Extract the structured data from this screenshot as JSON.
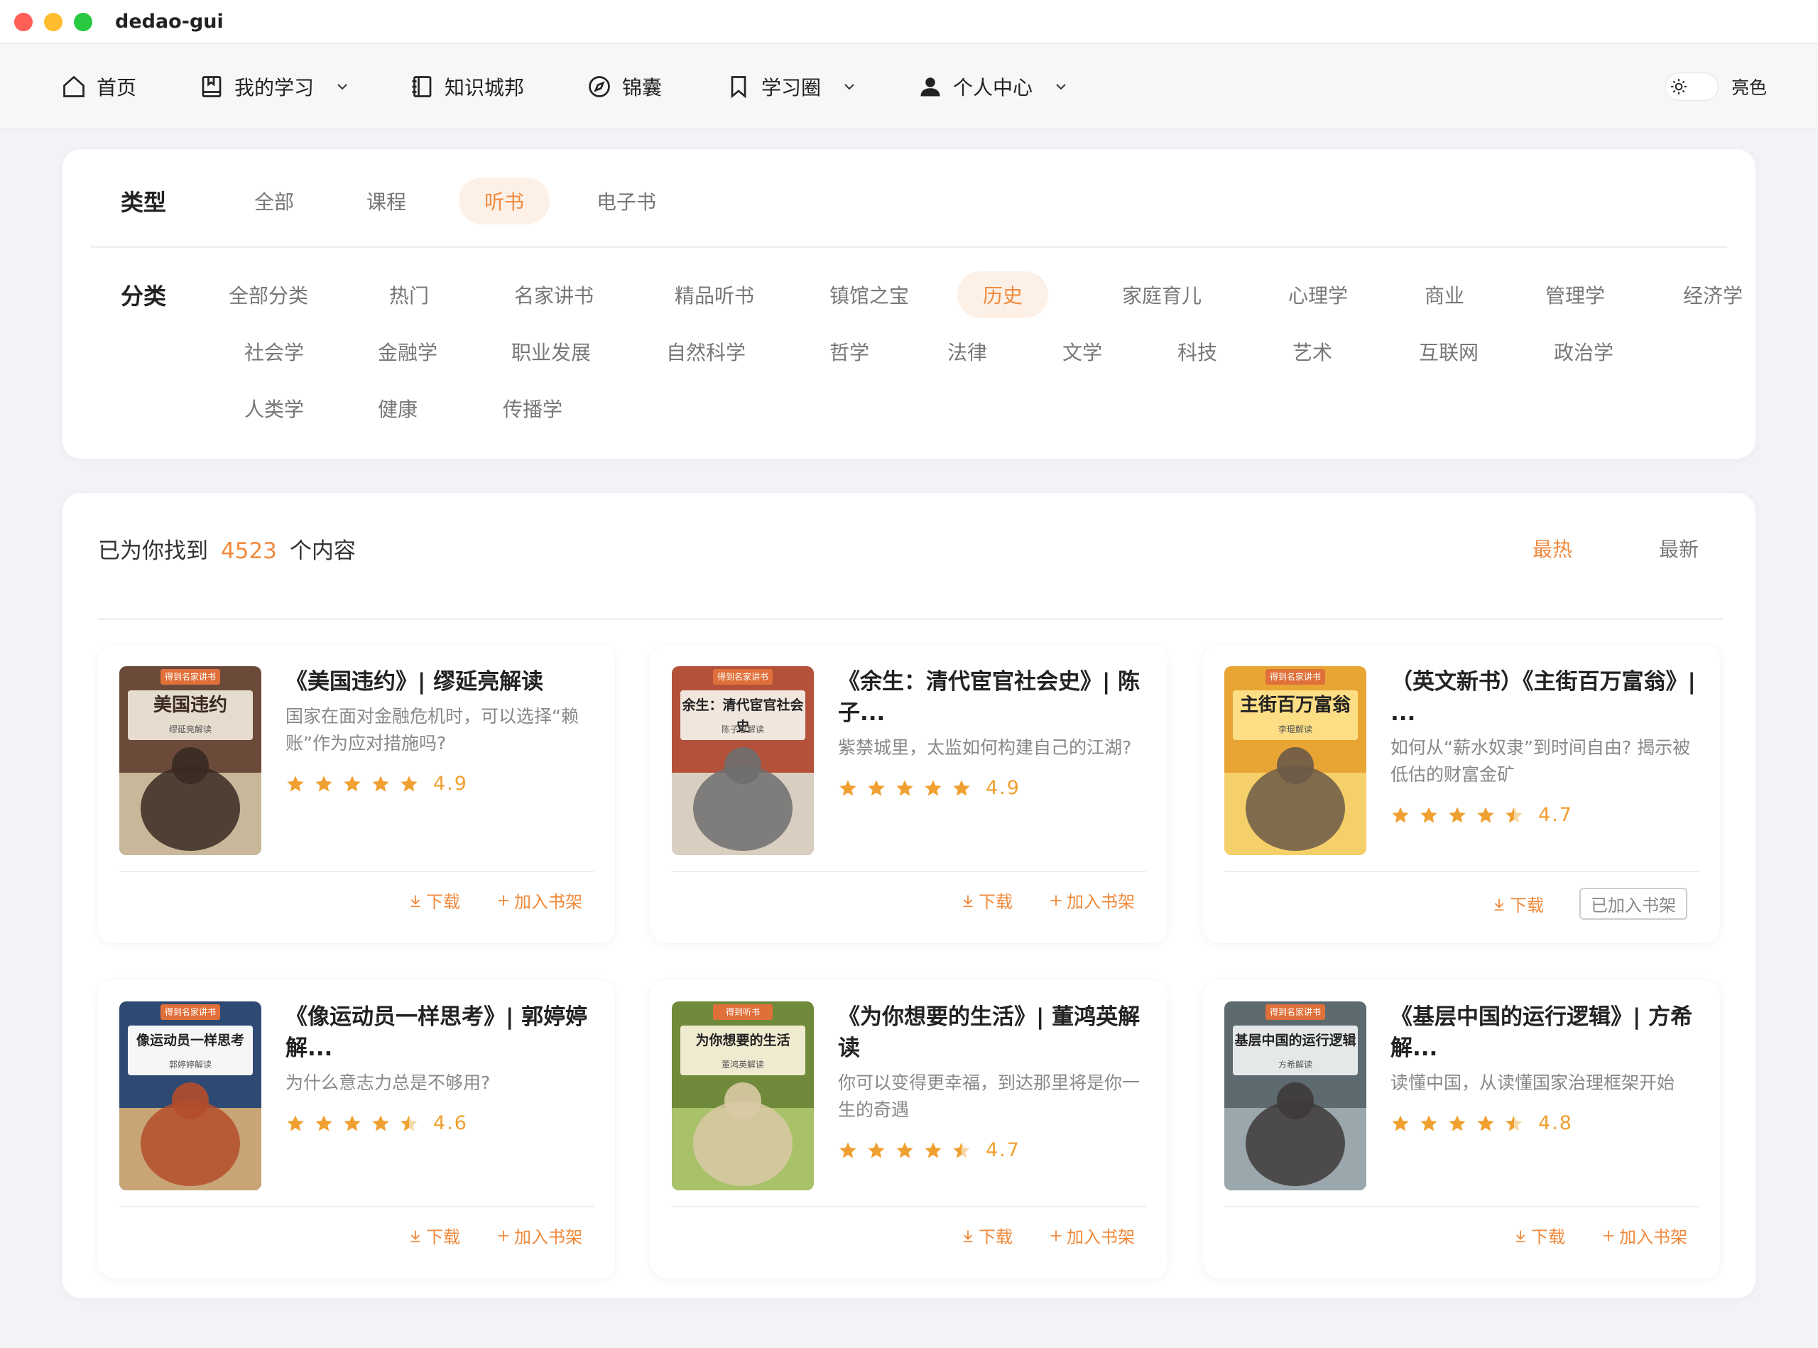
{
  "window": {
    "title": "dedao-gui"
  },
  "nav": {
    "items": [
      {
        "label": "首页",
        "icon": "home-icon",
        "dropdown": false
      },
      {
        "label": "我的学习",
        "icon": "book-icon",
        "dropdown": true
      },
      {
        "label": "知识城邦",
        "icon": "notebook-icon",
        "dropdown": false
      },
      {
        "label": "锦囊",
        "icon": "compass-icon",
        "dropdown": false
      },
      {
        "label": "学习圈",
        "icon": "bookmark-icon",
        "dropdown": true
      },
      {
        "label": "个人中心",
        "icon": "user-icon",
        "dropdown": true
      }
    ],
    "theme_label": "亮色"
  },
  "filters": {
    "type_label": "类型",
    "types": [
      "全部",
      "课程",
      "听书",
      "电子书"
    ],
    "active_type": "听书",
    "category_label": "分类",
    "categories": [
      "全部分类",
      "热门",
      "名家讲书",
      "精品听书",
      "镇馆之宝",
      "历史",
      "家庭育儿",
      "心理学",
      "商业",
      "管理学",
      "经济学",
      "社会学",
      "金融学",
      "职业发展",
      "自然科学",
      "哲学",
      "法律",
      "文学",
      "科技",
      "艺术",
      "互联网",
      "政治学",
      "人类学",
      "健康",
      "传播学"
    ],
    "active_category": "历史"
  },
  "results": {
    "prefix": "已为你找到",
    "count": "4523",
    "suffix": "个内容",
    "sort_hot": "最热",
    "sort_new": "最新",
    "download_label": "下载",
    "add_shelf_label": "加入书架",
    "added_shelf_label": "已加入书架",
    "books": [
      {
        "title": "《美国违约》| 缪延亮解读",
        "desc": "国家在面对金融危机时，可以选择“赖账”作为应对措施吗?",
        "rating": 4.9,
        "rating_text": "4.9",
        "cover_badge": "得到名家讲书",
        "cover_title": "美国违约",
        "cover_sub": "缪延亮解读",
        "added": false
      },
      {
        "title": "《余生：清代宦官社会史》| 陈子...",
        "desc": "紫禁城里，太监如何构建自己的江湖?",
        "rating": 4.9,
        "rating_text": "4.9",
        "cover_badge": "得到名家讲书",
        "cover_title": "余生：清代宦官社会史",
        "cover_sub": "陈子恩解读",
        "added": false
      },
      {
        "title": "（英文新书）《主街百万富翁》|  ...",
        "desc": "如何从“薪水奴隶”到时间自由? 揭示被低估的财富金矿",
        "rating": 4.7,
        "rating_text": "4.7",
        "cover_badge": "得到名家讲书",
        "cover_title": "主街百万富翁",
        "cover_sub": "李琨解读",
        "added": true
      },
      {
        "title": "《像运动员一样思考》| 郭婷婷解...",
        "desc": "为什么意志力总是不够用?",
        "rating": 4.6,
        "rating_text": "4.6",
        "cover_badge": "得到名家讲书",
        "cover_title": "像运动员一样思考",
        "cover_sub": "郭婷婷解读",
        "added": false
      },
      {
        "title": "《为你想要的生活》| 董鸿英解读",
        "desc": "你可以变得更幸福，到达那里将是你一生的奇遇",
        "rating": 4.7,
        "rating_text": "4.7",
        "cover_badge": "得到听书",
        "cover_title": "为你想要的生活",
        "cover_sub": "董鸿英解读",
        "added": false
      },
      {
        "title": "《基层中国的运行逻辑》| 方希解...",
        "desc": "读懂中国，从读懂国家治理框架开始",
        "rating": 4.8,
        "rating_text": "4.8",
        "cover_badge": "得到名家讲书",
        "cover_title": "基层中国的运行逻辑",
        "cover_sub": "方希解读",
        "added": false
      }
    ]
  },
  "colors": {
    "accent": "#f08a3d",
    "star": "#f0a030",
    "chip_active_bg": "#fdf0e7"
  }
}
